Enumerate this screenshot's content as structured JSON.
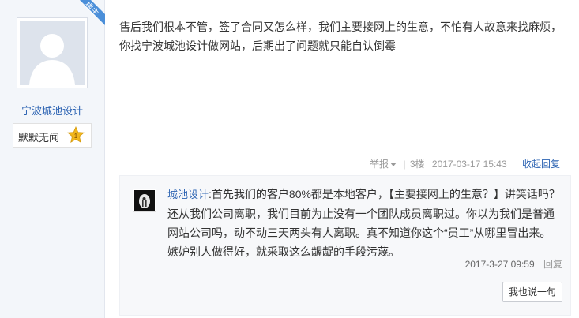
{
  "post": {
    "badge": "楼主",
    "username": "宁波城池设计",
    "rank": "默默无闻",
    "rank_level": "1",
    "body_line1": "售后我们根本不管，签了合同又怎么样，我们主要接网上的生意，不怕有人故意来找麻烦，",
    "body_line2": "你找宁波城池设计做网站，后期出了问题就只能自认倒霉",
    "report": "举报",
    "floor": "3楼",
    "time": "2017-03-17 15:43",
    "collapse": "收起回复"
  },
  "reply": {
    "username": "城池设计",
    "colon": ":",
    "text": "首先我们的客户80%都是本地客户，【主要接网上的生意？】讲笑话吗？还从我们公司离职，我们目前为止没有一个团队成员离职过。你以为我们是普通网站公司吗，动不动三天两头有人离职。真不知道你这个“员工”从哪里冒出来。嫉妒别人做得好，就采取这么龌龊的手段污蔑。",
    "time": "2017-3-27 09:59",
    "reply_label": "回复",
    "say_button": "我也说一句"
  },
  "colors": {
    "link_blue": "#2d64b3",
    "badge_blue": "#4b8fd9",
    "star_gold": "#f2b61b"
  }
}
